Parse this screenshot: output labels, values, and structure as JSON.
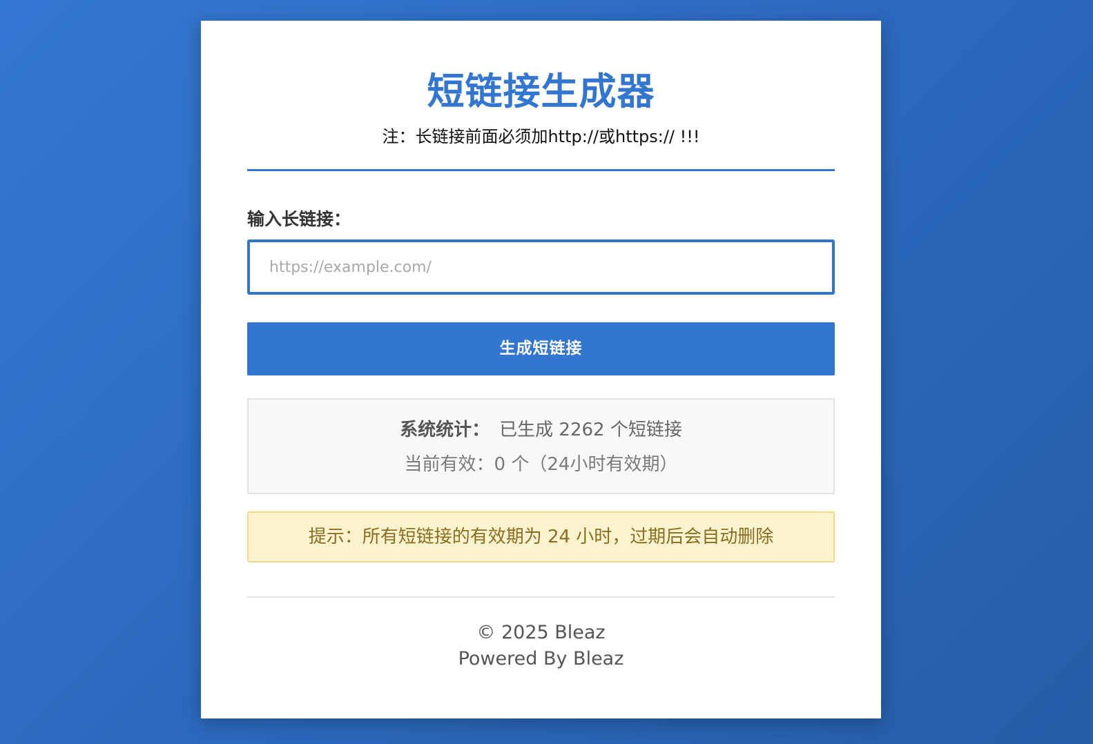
{
  "header": {
    "title": "短链接生成器",
    "note": "注：长链接前面必须加http://或https:// !!!"
  },
  "form": {
    "label": "输入长链接：",
    "input_value": "",
    "input_placeholder": "https://example.com/",
    "submit_label": "生成短链接"
  },
  "stats": {
    "label": "系统统计：",
    "generated_text": "已生成 2262 个短链接",
    "active_text": "当前有效：0 个（24小时有效期）"
  },
  "tip": {
    "text": "提示：所有短链接的有效期为 24 小时，过期后会自动删除"
  },
  "footer": {
    "copyright": "© 2025 Bleaz",
    "powered_by": "Powered By Bleaz"
  },
  "colors": {
    "accent": "#3276d0",
    "background_gradient_start": "#3477d2",
    "background_gradient_end": "#265ca6",
    "tip_background": "#fdf4cf",
    "tip_text": "#8a6d1f"
  }
}
